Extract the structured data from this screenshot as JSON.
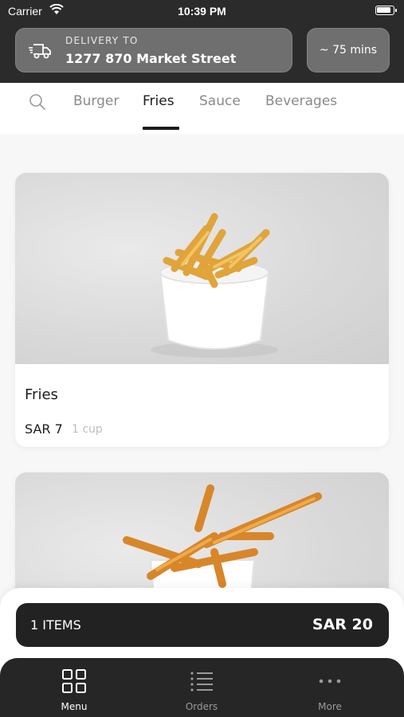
{
  "status_bar": {
    "carrier": "Carrier",
    "time": "10:39 PM"
  },
  "delivery": {
    "label": "DELIVERY TO",
    "address": "1277 870 Market Street",
    "icon": "delivery-truck-icon"
  },
  "eta": {
    "text": "~ 75 mins"
  },
  "tabs": [
    {
      "label": "Burger",
      "active": false
    },
    {
      "label": "Fries",
      "active": true
    },
    {
      "label": "Sauce",
      "active": false
    },
    {
      "label": "Beverages",
      "active": false
    }
  ],
  "products": [
    {
      "name": "Fries",
      "price": "SAR 7",
      "unit": "1 cup"
    }
  ],
  "cart": {
    "items_label": "1 ITEMS",
    "total": "SAR 20"
  },
  "bottom_nav": [
    {
      "label": "Menu",
      "icon": "grid-icon",
      "active": true
    },
    {
      "label": "Orders",
      "icon": "list-icon",
      "active": false
    },
    {
      "label": "More",
      "icon": "more-dots-icon",
      "active": false
    }
  ],
  "colors": {
    "header": "#2b2b2b",
    "accent": "#1c1c1c",
    "nav": "#262626",
    "muted": "#8a8a8a"
  }
}
